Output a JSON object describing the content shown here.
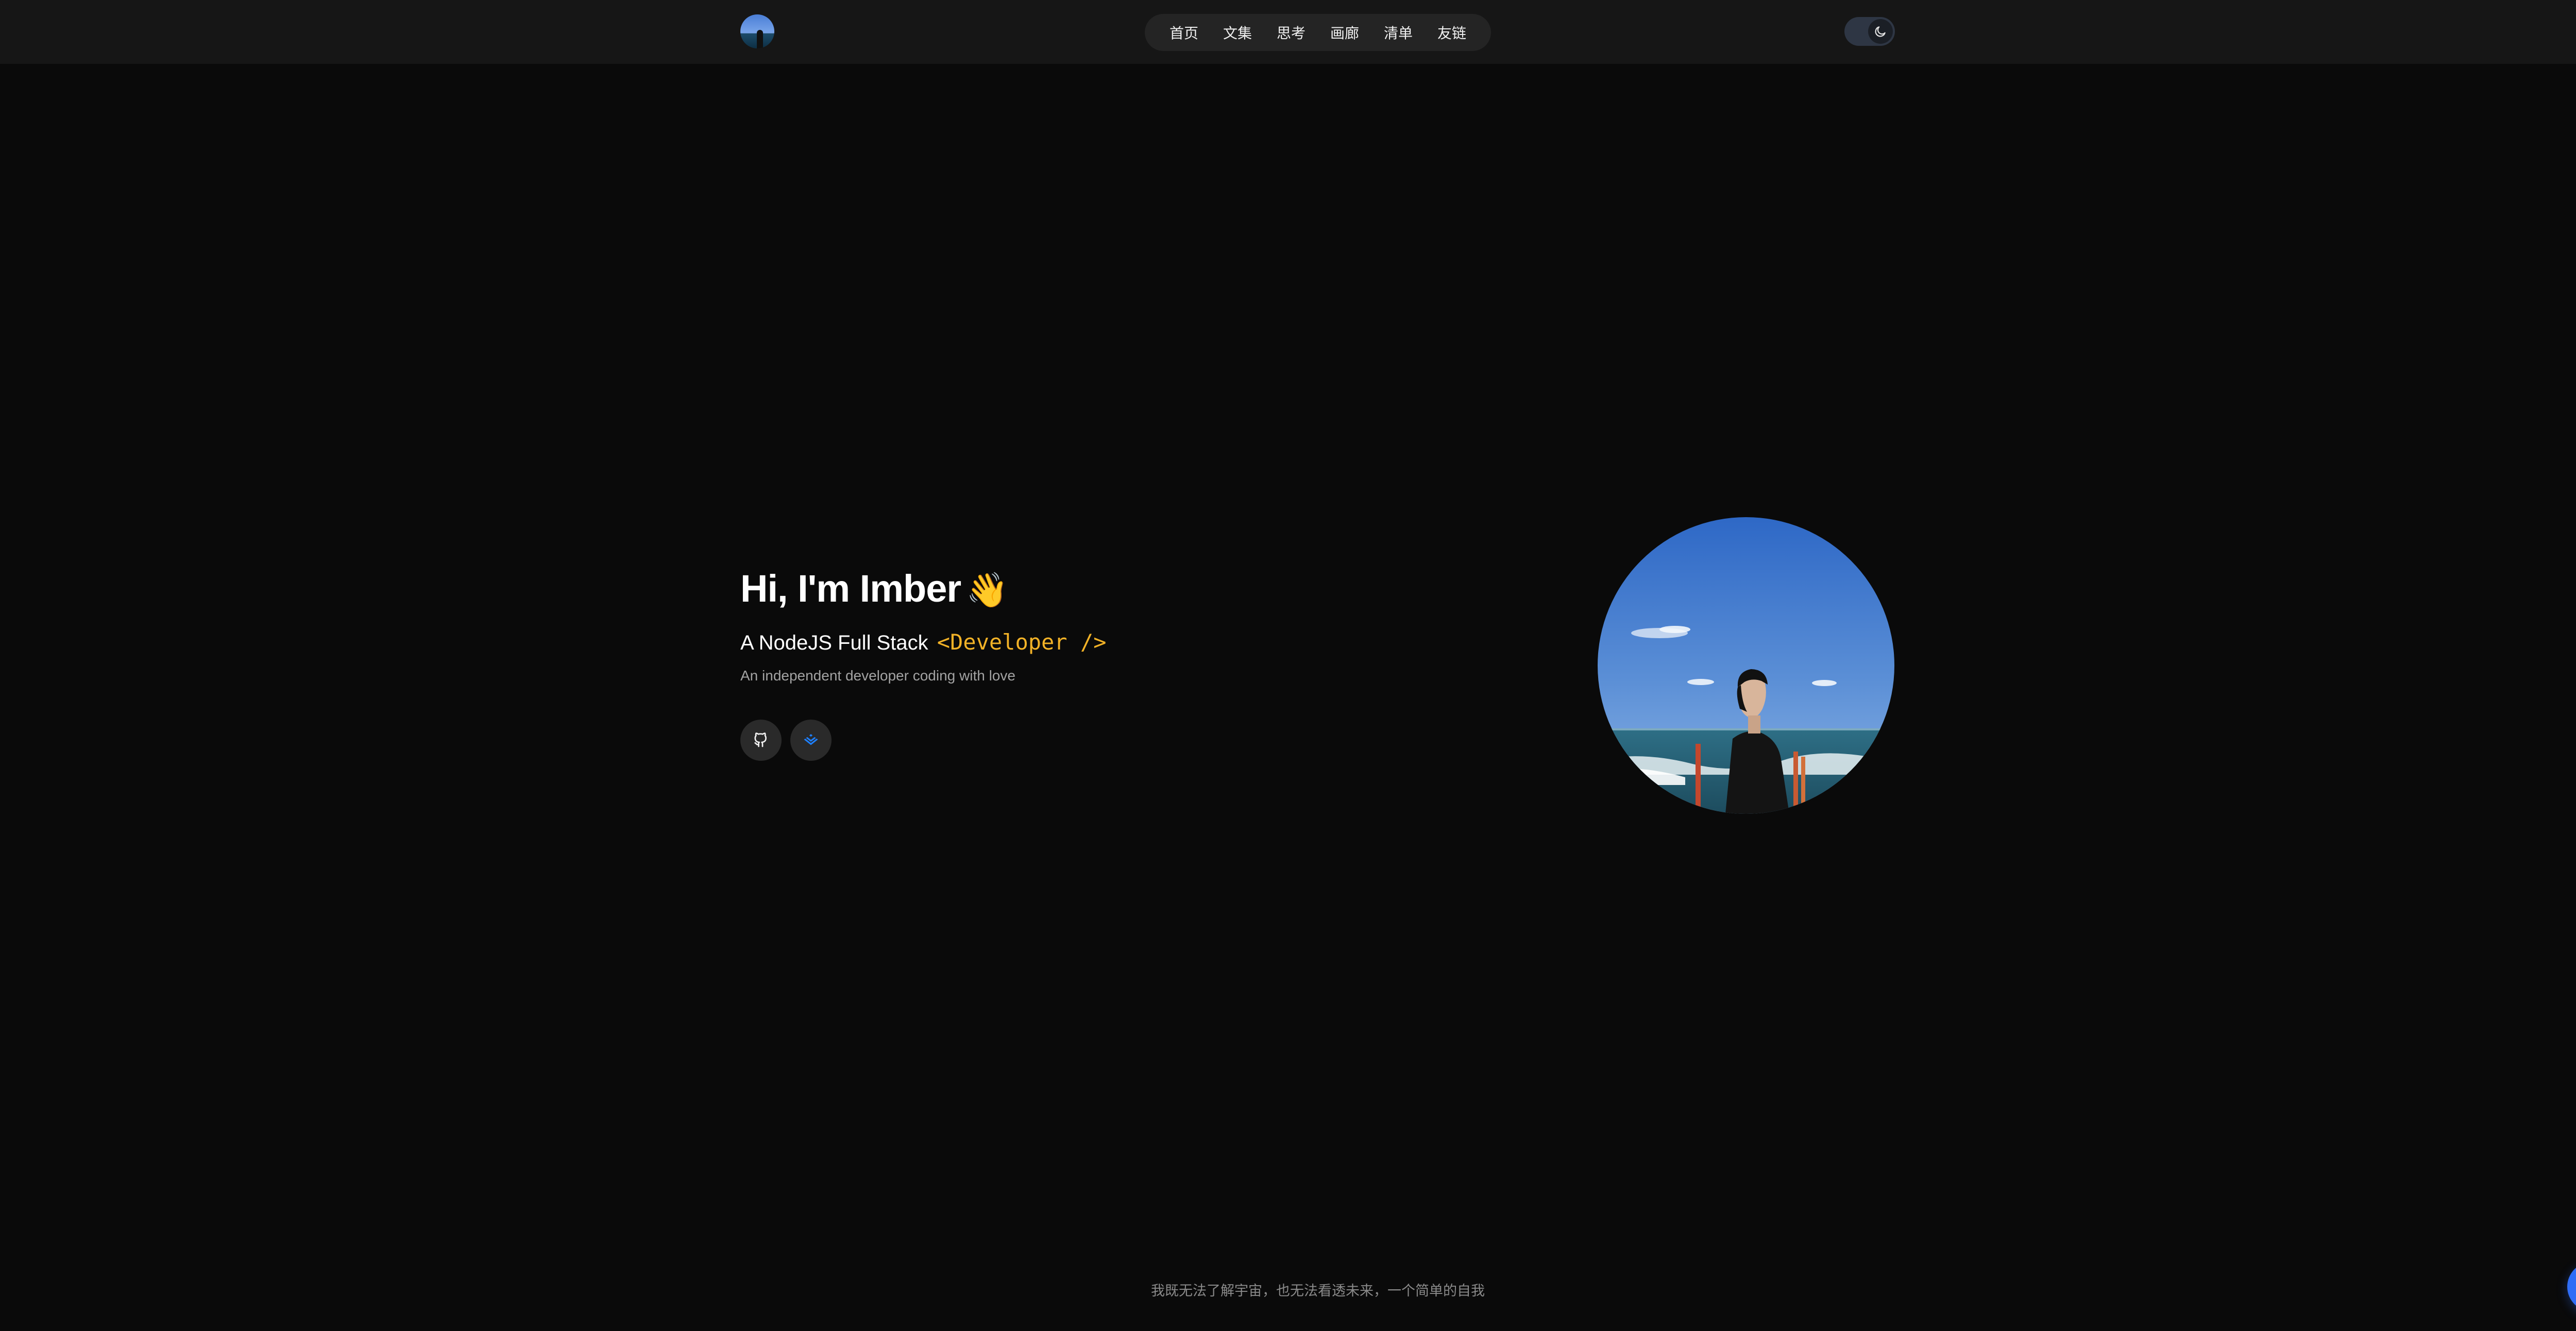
{
  "header": {
    "logo_alt": "avatar",
    "nav": [
      {
        "label": "首页"
      },
      {
        "label": "文集"
      },
      {
        "label": "思考"
      },
      {
        "label": "画廊"
      },
      {
        "label": "清单"
      },
      {
        "label": "友链"
      }
    ],
    "theme_toggle_icon": "moon-icon"
  },
  "hero": {
    "title": "Hi, I'm Imber",
    "title_emoji": "👋",
    "subtitle_prefix": "A NodeJS Full Stack",
    "subtitle_code": "<Developer />",
    "description": "An independent developer coding with love",
    "social_links": [
      {
        "icon": "github-icon"
      },
      {
        "icon": "juejin-icon"
      }
    ],
    "portrait_alt": "portrait at seaside"
  },
  "footer": {
    "quote": "我既无法了解宇宙，也无法看透未来，一个简单的自我"
  },
  "chat_icon": "chat-bubble-icon",
  "colors": {
    "background": "#0a0a0a",
    "header": "#161616",
    "accent_code": "#f2b227",
    "chat_button": "#2f6df6",
    "juejin": "#1e80ff"
  }
}
